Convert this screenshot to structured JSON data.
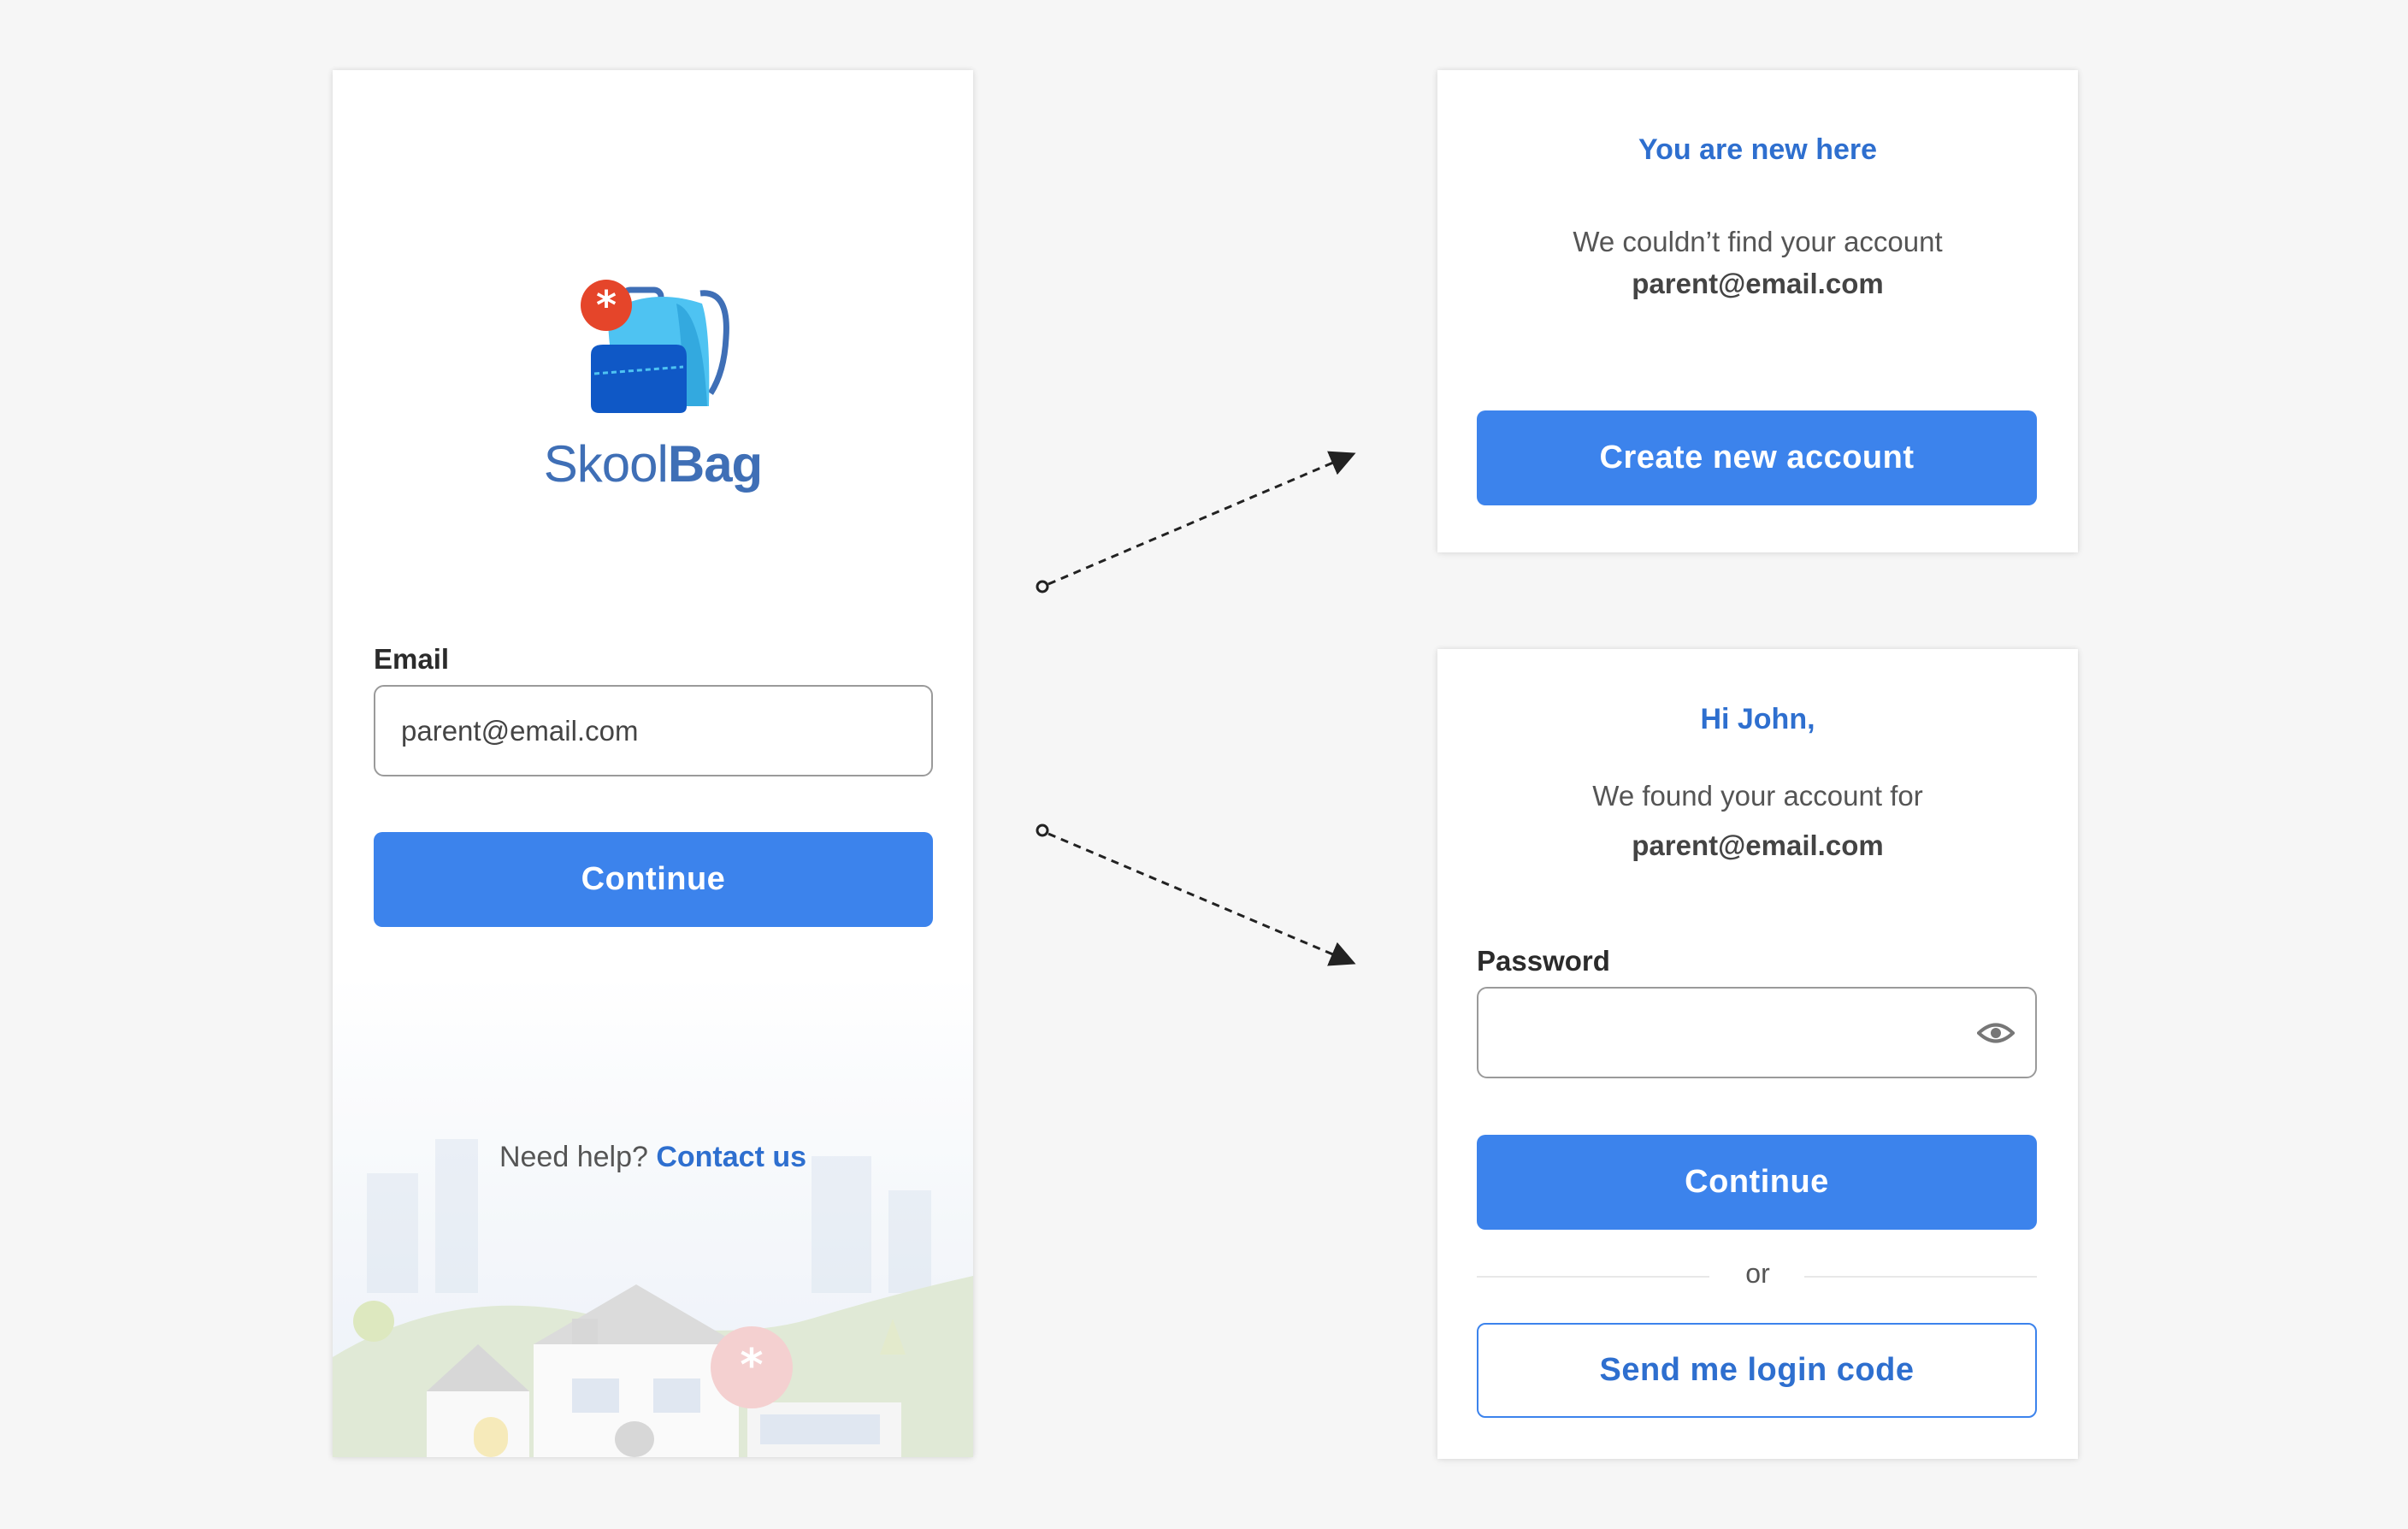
{
  "login": {
    "brand_light": "Skool",
    "brand_bold": "Bag",
    "email_label": "Email",
    "email_value": "parent@email.com",
    "continue_label": "Continue",
    "help_text": "Need help?",
    "help_link": "Contact us"
  },
  "new_account": {
    "heading": "You are new here",
    "message": "We couldn’t find your account",
    "email": "parent@email.com",
    "create_label": "Create new account"
  },
  "found_account": {
    "heading": "Hi John,",
    "message": "We found your account for",
    "email": "parent@email.com",
    "password_label": "Password",
    "password_value": "",
    "continue_label": "Continue",
    "or_text": "or",
    "login_code_label": "Send me login code"
  },
  "colors": {
    "primary": "#3c83ec",
    "link": "#2e6fcf",
    "brand": "#3f6fb6",
    "badge": "#e5452a",
    "background": "#f6f6f6"
  },
  "icons": {
    "logo": "backpack-logo-icon",
    "password_toggle": "eye-icon"
  }
}
